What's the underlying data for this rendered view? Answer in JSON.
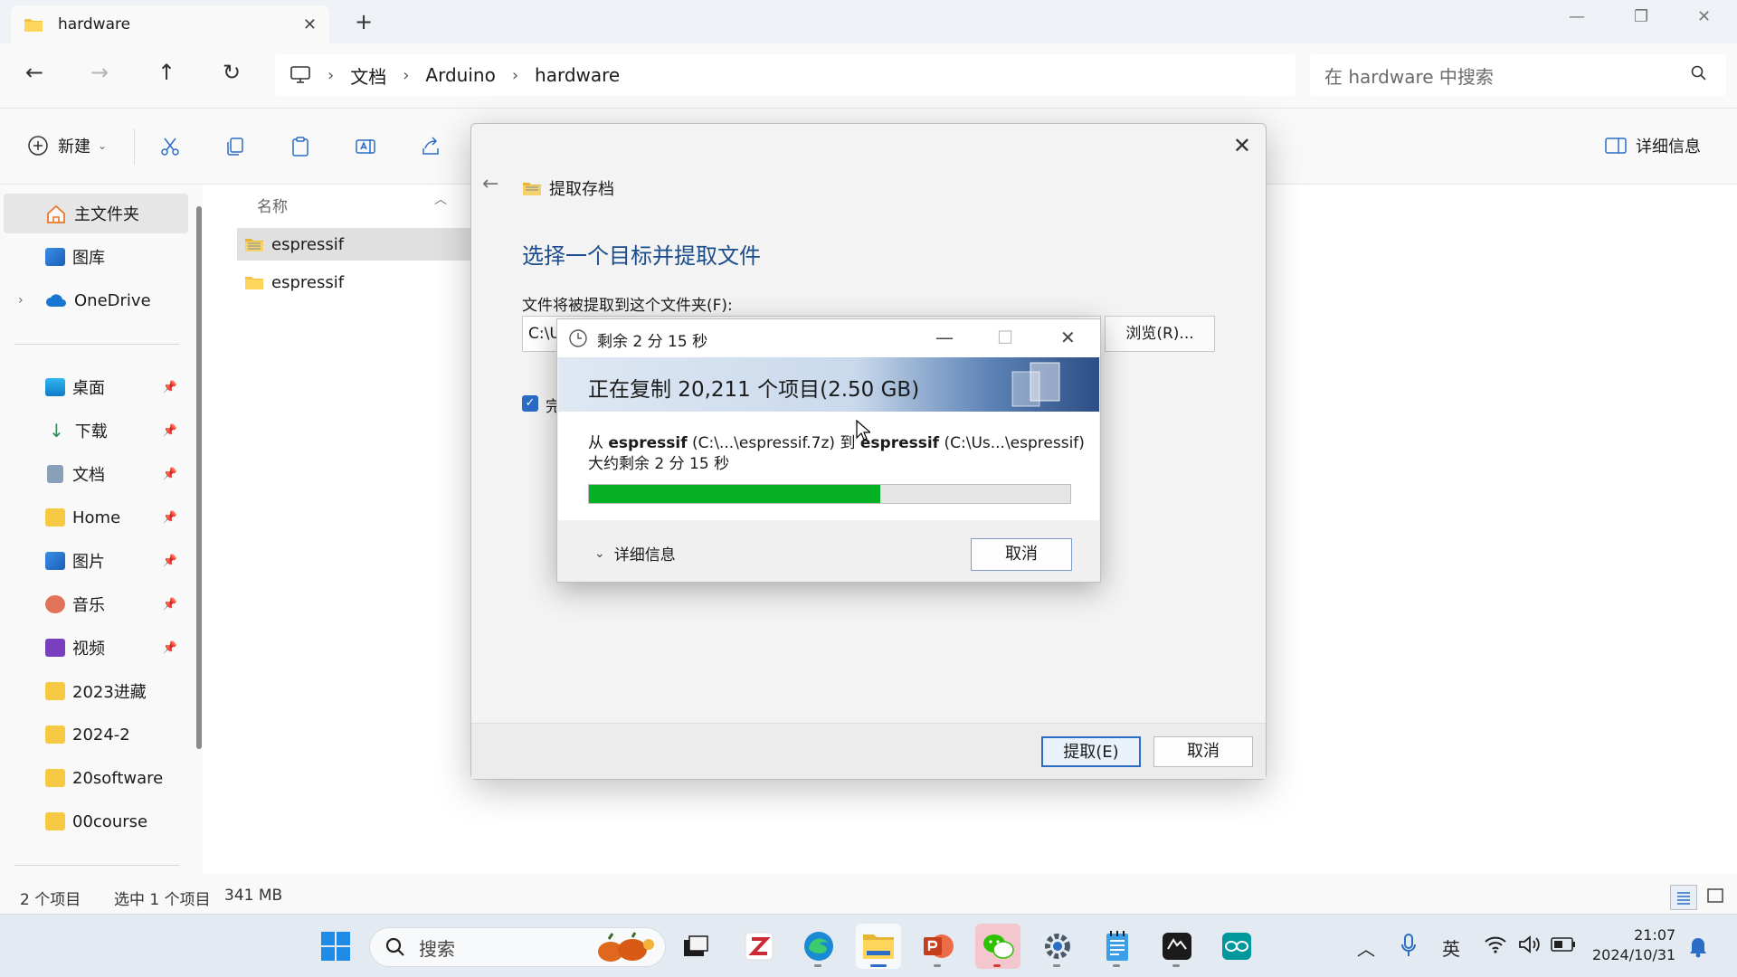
{
  "titlebar": {
    "tab_title": "hardware",
    "new_tab": "+",
    "minimize": "—",
    "restore": "❐",
    "close": "✕"
  },
  "address": {
    "back": "←",
    "forward": "→",
    "up": "↑",
    "refresh": "↻",
    "crumbs": [
      "文档",
      "Arduino",
      "hardware"
    ],
    "separator": "›",
    "search_placeholder": "在 hardware 中搜索"
  },
  "commandbar": {
    "new_label": "新建",
    "details_label": "详细信息"
  },
  "sidebar": {
    "home": "主文件夹",
    "gallery": "图库",
    "onedrive": "OneDrive",
    "pinned": [
      {
        "label": "桌面",
        "icon": "desktop-icon"
      },
      {
        "label": "下载",
        "icon": "download-icon"
      },
      {
        "label": "文档",
        "icon": "document-icon"
      },
      {
        "label": "Home",
        "icon": "folder-icon"
      },
      {
        "label": "图片",
        "icon": "pictures-icon"
      },
      {
        "label": "音乐",
        "icon": "music-icon"
      },
      {
        "label": "视频",
        "icon": "video-icon"
      }
    ],
    "folders": [
      "2023进藏",
      "2024-2",
      "20software",
      "00course"
    ]
  },
  "filelist": {
    "column_name": "名称",
    "rows": [
      {
        "name": "espressif",
        "type": "archive",
        "selected": true
      },
      {
        "name": "espressif",
        "type": "folder",
        "selected": false
      }
    ]
  },
  "statusbar": {
    "count": "2 个项目",
    "selection": "选中 1 个项目",
    "size": "341 MB"
  },
  "extract_dialog": {
    "title": "提取存档",
    "heading": "选择一个目标并提取文件",
    "dest_label": "文件将被提取到这个文件夹(F):",
    "dest_value": "C:\\U",
    "browse": "浏览(R)...",
    "checkbox_label": "完",
    "extract_button": "提取(E)",
    "cancel_button": "取消"
  },
  "progress_dialog": {
    "title": "剩余 2 分 15 秒",
    "heading": "正在复制 20,211 个项目(2.50 GB)",
    "from_prefix": "从",
    "from_name": "espressif",
    "from_path": "(C:\\...\\espressif.7z)",
    "to_word": "到",
    "to_name": "espressif",
    "to_path": "(C:\\Us...\\espressif)",
    "remaining": "大约剩余 2 分 15 秒",
    "progress": 0.605,
    "details": "详细信息",
    "cancel": "取消"
  },
  "taskbar": {
    "search_label": "搜索",
    "ime": "英",
    "time": "21:07",
    "date": "2024/10/31"
  },
  "colors": {
    "accent": "#2a6cc6",
    "progress_green": "#06b025",
    "heading_blue": "#1a4c8b"
  }
}
